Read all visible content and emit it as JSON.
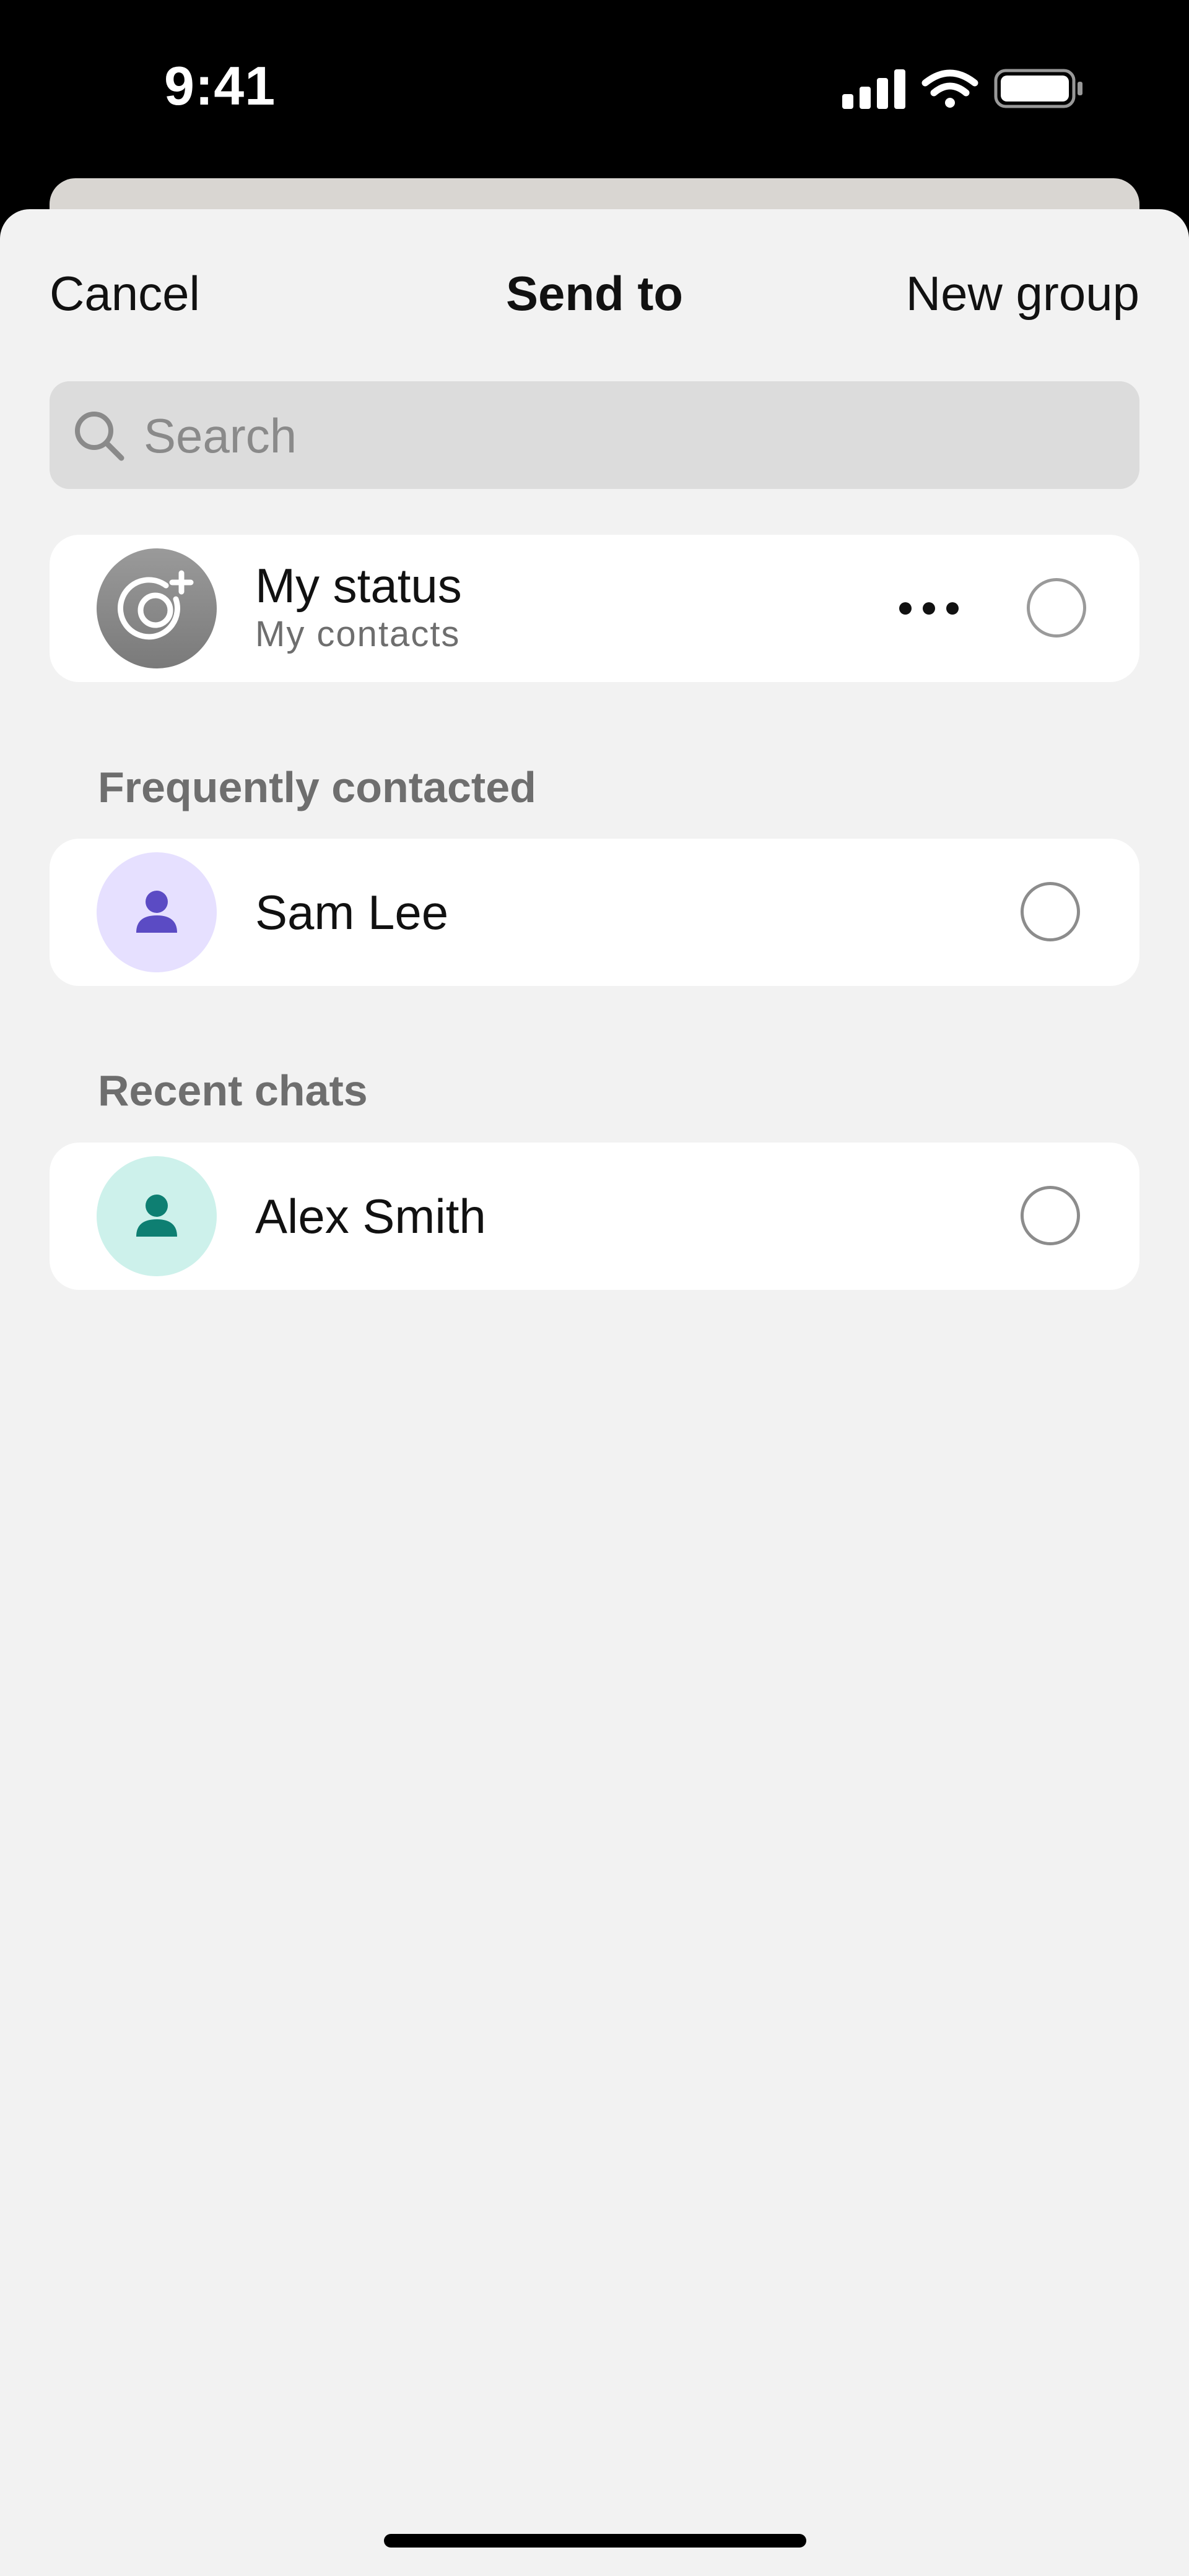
{
  "status_bar": {
    "time": "9:41",
    "icons": [
      "signal-icon",
      "wifi-icon",
      "battery-icon"
    ]
  },
  "nav": {
    "cancel_label": "Cancel",
    "title": "Send to",
    "new_group_label": "New group"
  },
  "search": {
    "placeholder": "Search",
    "value": ""
  },
  "my_status": {
    "title": "My status",
    "subtitle": "My contacts",
    "icon": "status-camera-icon",
    "more_icon": "more-horizontal-icon"
  },
  "sections": [
    {
      "header": "Frequently contacted",
      "items": [
        {
          "name": "Sam Lee",
          "avatar_color": "#E6E0FF",
          "icon_color": "#5B4BC4"
        }
      ]
    },
    {
      "header": "Recent chats",
      "items": [
        {
          "name": "Alex Smith",
          "avatar_color": "#CDF1EB",
          "icon_color": "#0E7F72"
        }
      ]
    }
  ],
  "colors": {
    "sheet_background": "#F2F2F2",
    "search_background": "#DCDCDC",
    "text_primary": "#111111",
    "text_secondary": "#6E6E6E"
  }
}
